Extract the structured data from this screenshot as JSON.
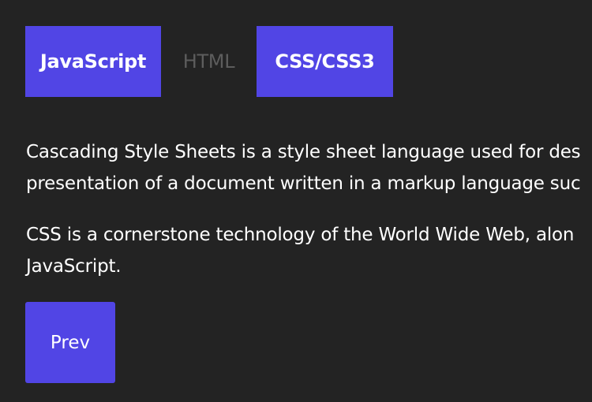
{
  "tabs": [
    {
      "label": "JavaScript",
      "active": true
    },
    {
      "label": "HTML",
      "active": false
    },
    {
      "label": "CSS/CSS3",
      "active": true
    }
  ],
  "content": {
    "paragraphs": [
      {
        "line1": "Cascading Style Sheets is a style sheet language used for des",
        "line2": "presentation of a document written in a markup language suc"
      },
      {
        "line1": "CSS is a cornerstone technology of the World Wide Web, alon",
        "line2": "JavaScript."
      }
    ]
  },
  "buttons": {
    "prev_label": "Prev"
  },
  "colors": {
    "background": "#232323",
    "accent": "#5145e5",
    "text": "#ffffff",
    "inactive_tab_text": "#5d5d5d"
  }
}
